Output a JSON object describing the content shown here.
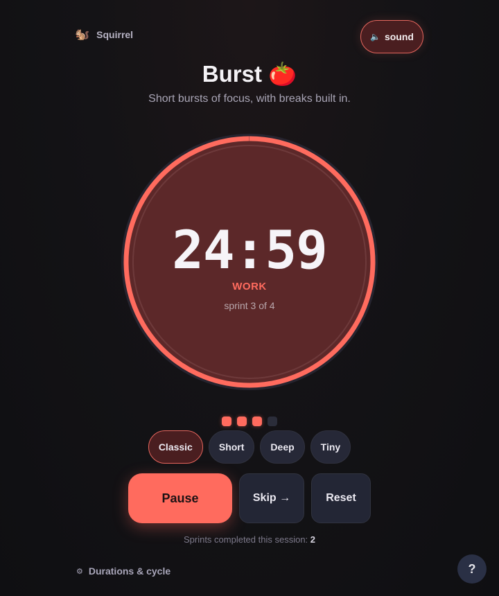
{
  "brand": {
    "icon": "🐿️",
    "name": "Squirrel"
  },
  "sound": {
    "icon": "speaker-muted-icon",
    "glyph": "🔈",
    "label": "sound"
  },
  "header": {
    "title": "Burst 🍅",
    "subtitle": "Short bursts of focus, with breaks built in."
  },
  "timer": {
    "display": "24:59",
    "phase": "WORK",
    "sprint": "sprint 3 of 4",
    "progress": 0.9993
  },
  "cycle": {
    "completed": 3,
    "total": 4
  },
  "presets": [
    {
      "label": "Classic",
      "active": true
    },
    {
      "label": "Short",
      "active": false
    },
    {
      "label": "Deep",
      "active": false
    },
    {
      "label": "Tiny",
      "active": false
    }
  ],
  "controls": {
    "pause": "Pause",
    "skip": "Skip →",
    "reset": "Reset"
  },
  "stats": {
    "label": "Sprints completed this session:",
    "value": "2"
  },
  "settings": {
    "icon": "⚙",
    "label": "Durations & cycle"
  },
  "help": {
    "label": "?"
  },
  "colors": {
    "accent": "#ff6b5e",
    "ring_track": "#2a2a36",
    "ring_fill": "#5c2829",
    "background": "#121216"
  }
}
